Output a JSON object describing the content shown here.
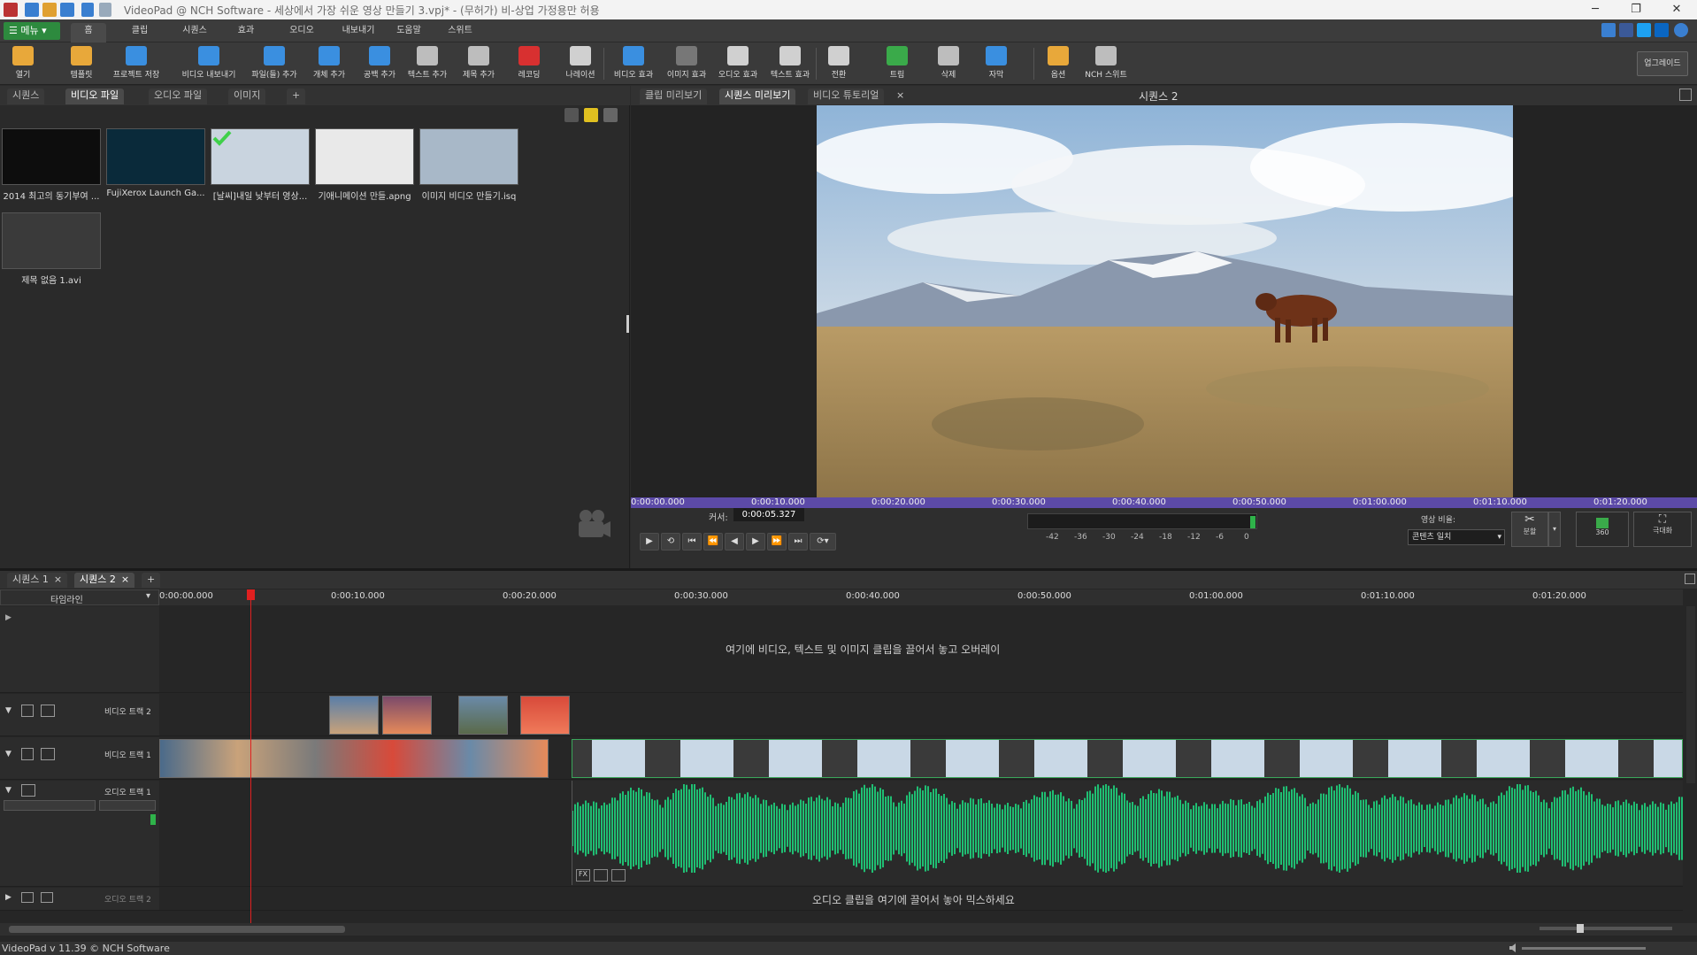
{
  "window": {
    "title": "VideoPad @ NCH Software - 세상에서 가장 쉬운 영상 만들기 3.vpj* - (무허가) 비-상업 가정용만 허용",
    "minimize": "─",
    "restore": "❐",
    "close": "✕"
  },
  "menu": {
    "menu_button": "☰ 메뉴 ▾",
    "tabs": [
      "홈",
      "클립",
      "시퀀스",
      "효과",
      "오디오",
      "내보내기",
      "도움말",
      "스위트"
    ]
  },
  "toolbar": {
    "buttons": [
      {
        "label": "열기",
        "icon": "folder-open-icon",
        "color": "#e8a83a"
      },
      {
        "label": "템플릿",
        "icon": "template-icon",
        "color": "#e8a83a"
      },
      {
        "label": "프로젝트 저장",
        "icon": "save-icon",
        "color": "#3a8fe0"
      },
      {
        "label": "비디오 내보내기",
        "icon": "export-video-icon",
        "color": "#3a8fe0"
      },
      {
        "label": "파일(들) 추가",
        "icon": "add-files-icon",
        "color": "#3a8fe0"
      },
      {
        "label": "개체 추가",
        "icon": "add-object-icon",
        "color": "#3a8fe0"
      },
      {
        "label": "공백 추가",
        "icon": "add-blank-icon",
        "color": "#3a8fe0"
      },
      {
        "label": "텍스트 추가",
        "icon": "add-text-icon",
        "color": "#bdbdbd"
      },
      {
        "label": "제목 추가",
        "icon": "add-title-icon",
        "color": "#bdbdbd"
      },
      {
        "label": "레코딩",
        "icon": "record-icon",
        "color": "#d83030"
      },
      {
        "label": "나레이션",
        "icon": "narration-icon",
        "color": "#d0d0d0"
      },
      {
        "label": "비디오 효과",
        "icon": "video-fx-icon",
        "color": "#3a8fe0"
      },
      {
        "label": "이미지 효과",
        "icon": "image-fx-icon",
        "color": "#777777"
      },
      {
        "label": "오디오 효과",
        "icon": "audio-fx-icon",
        "color": "#d0d0d0"
      },
      {
        "label": "텍스트 효과",
        "icon": "text-fx-icon",
        "color": "#d0d0d0"
      },
      {
        "label": "전환",
        "icon": "transition-icon",
        "color": "#d0d0d0"
      },
      {
        "label": "트림",
        "icon": "trim-icon",
        "color": "#3aaa4a"
      },
      {
        "label": "삭제",
        "icon": "delete-icon",
        "color": "#bdbdbd"
      },
      {
        "label": "자막",
        "icon": "subtitle-icon",
        "color": "#3a8fe0"
      },
      {
        "label": "옵션",
        "icon": "options-icon",
        "color": "#e8a83a"
      },
      {
        "label": "NCH 스위트",
        "icon": "nch-suite-icon",
        "color": "#bdbdbd"
      }
    ],
    "upgrade": "업그레이드"
  },
  "bin": {
    "tabs": [
      "시퀀스",
      "비디오 파일",
      "오디오 파일",
      "이미지"
    ],
    "active_tab": 1,
    "add_tab": "+",
    "files": [
      {
        "name": "2014 최고의 동기부여 ...",
        "color": "#0d0d0d"
      },
      {
        "name": "FujiXerox Launch Ga...",
        "color": "#0a2a3a"
      },
      {
        "name": "[날씨]내일 낮부터 영상...",
        "color": "#c9d4df"
      },
      {
        "name": "기애니메이션 만들.apng",
        "color": "#e9e9e9"
      },
      {
        "name": "이미지 비디오 만들기.isq",
        "color": "#a8b8c8"
      },
      {
        "name": "제목 없음 1.avi",
        "color": "#3a3a3a"
      }
    ]
  },
  "preview": {
    "tabs": [
      "클립 미리보기",
      "시퀀스 미리보기",
      "비디오 튜토리얼"
    ],
    "active_tab": 1,
    "sequence_title": "시퀀스 2",
    "ruler_ticks": [
      "0:00:00.000",
      "0:00:10.000",
      "0:00:20.000",
      "0:00:30.000",
      "0:00:40.000",
      "0:00:50.000",
      "0:01:00.000",
      "0:01:10.000",
      "0:01:20.000"
    ],
    "cursor_label": "커서:",
    "cursor_value": "0:00:05.327",
    "meter_labels": [
      "-42",
      "-36",
      "-30",
      "-24",
      "-18",
      "-12",
      "-6",
      "0"
    ],
    "aspect_label": "영상 비율:",
    "aspect_value": "콘텐츠 일치",
    "split_label": "분할",
    "btn_360": "360",
    "maximize_label": "극대화"
  },
  "timeline": {
    "tabs": [
      "시퀀스 1",
      "시퀀스 2"
    ],
    "active_tab": 1,
    "add_tab": "+",
    "mode": "타임라인",
    "ruler_ticks": [
      "0:00:00.000",
      "0:00:10.000",
      "0:00:20.000",
      "0:00:30.000",
      "0:00:40.000",
      "0:00:50.000",
      "0:01:00.000",
      "0:01:10.000",
      "0:01:20.000"
    ],
    "overlay_hint": "여기에 비디오, 텍스트 및 이미지 클립을 끌어서 놓고 오버레이",
    "video_track_2": "비디오 트랙 2",
    "video_track_1": "비디오 트랙 1",
    "audio_track_1": "오디오 트랙 1",
    "audio_track_2": "오디오 트랙 2",
    "audio_hint": "오디오 클립을 여기에 끌어서 놓아 믹스하세요"
  },
  "status": {
    "text": "VideoPad v 11.39 © NCH Software"
  },
  "colors": {
    "accent_green": "#2d8a3e",
    "ruler_purple": "#5c4aa8",
    "waveform": "#1fbf73",
    "playhead": "#e02020"
  }
}
